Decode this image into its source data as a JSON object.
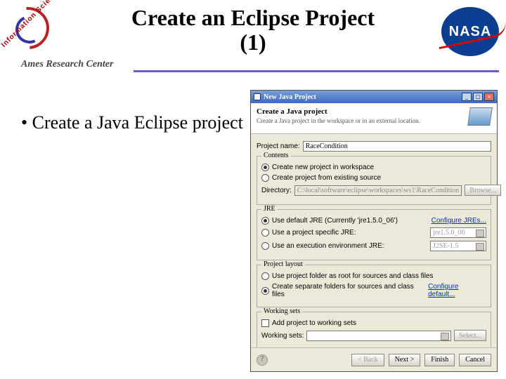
{
  "header": {
    "title_l1": "Create an Eclipse Project",
    "title_l2": "(1)",
    "arc_text": "Ames Research Center",
    "diag_text": "Information Sciences & Technology",
    "nasa": "NASA"
  },
  "bullet": {
    "text": "Create a Java Eclipse project",
    "marker": "•"
  },
  "dialog": {
    "window_title": "New Java Project",
    "banner_title": "Create a Java project",
    "banner_sub": "Create a Java project in the workspace or in an external location.",
    "project_name_label": "Project name:",
    "project_name_value": "RaceCondition",
    "contents": {
      "legend": "Contents",
      "opt1": "Create new project in workspace",
      "opt2": "Create project from existing source",
      "dir_label": "Directory:",
      "dir_value": "C:\\local\\software\\eclipse\\workspaces\\ws1\\RaceCondition",
      "browse": "Browse..."
    },
    "jre": {
      "legend": "JRE",
      "opt1": "Use default JRE (Currently 'jre1.5.0_06')",
      "opt2": "Use a project specific JRE:",
      "opt2_val": "jre1.5.0_06",
      "opt3": "Use an execution environment JRE:",
      "opt3_val": "J2SE-1.5",
      "configure": "Configure JREs..."
    },
    "layout": {
      "legend": "Project layout",
      "opt1": "Use project folder as root for sources and class files",
      "opt2": "Create separate folders for sources and class files",
      "configure": "Configure default..."
    },
    "ws": {
      "legend": "Working sets",
      "chk": "Add project to working sets",
      "label": "Working sets:",
      "select": "Select..."
    },
    "buttons": {
      "back": "< Back",
      "next": "Next >",
      "finish": "Finish",
      "cancel": "Cancel"
    }
  }
}
